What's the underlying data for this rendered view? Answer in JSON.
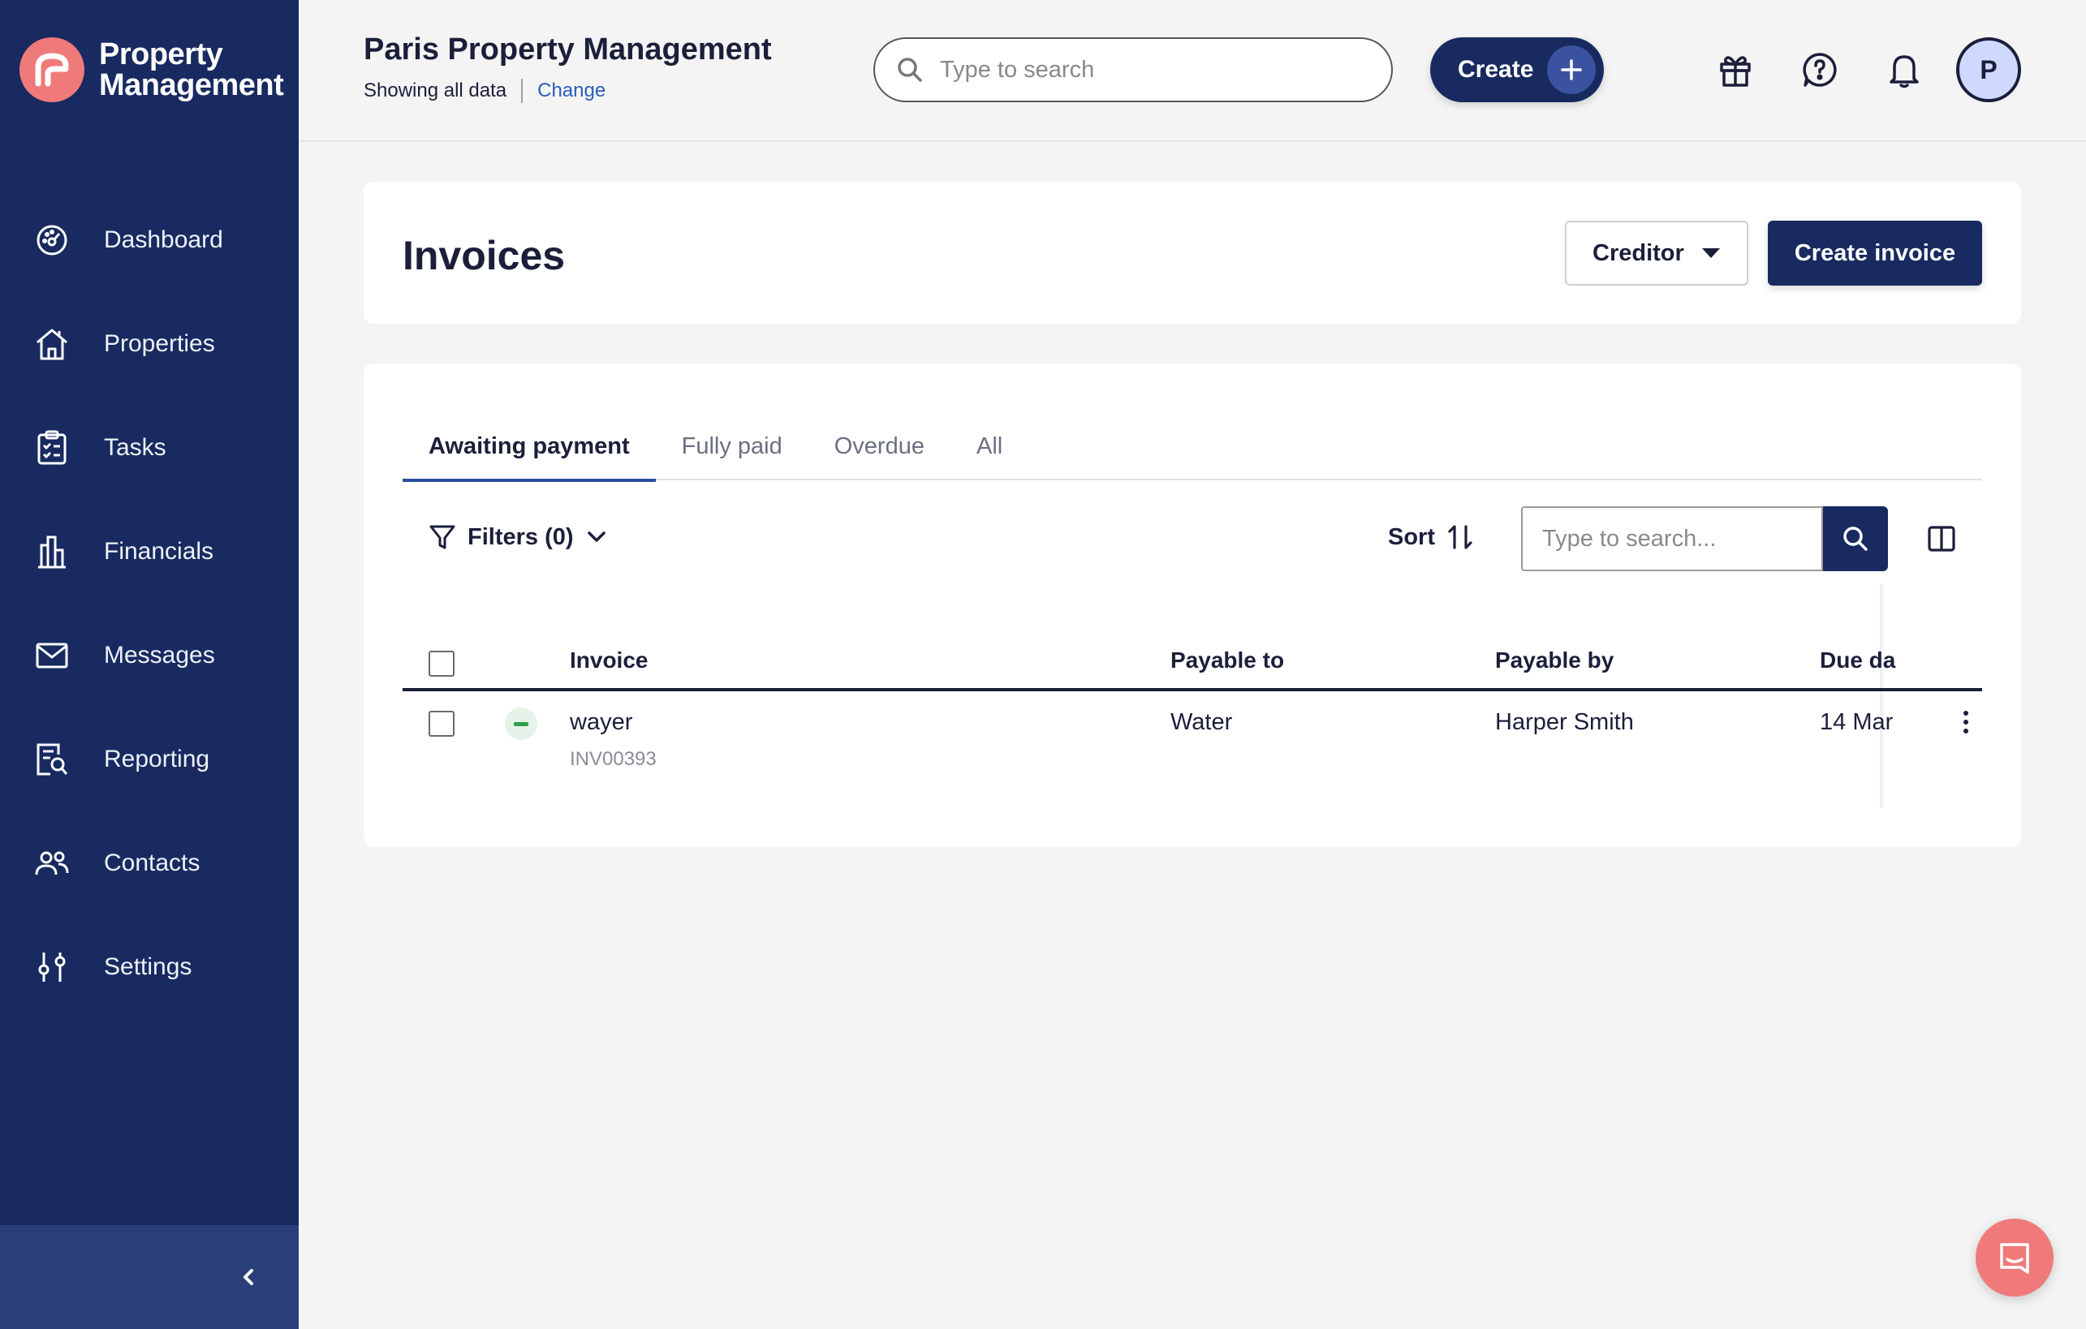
{
  "brand": {
    "name": "Property Management"
  },
  "sidebar": {
    "items": [
      {
        "label": "Dashboard",
        "icon": "dashboard-icon"
      },
      {
        "label": "Properties",
        "icon": "home-icon"
      },
      {
        "label": "Tasks",
        "icon": "clipboard-icon"
      },
      {
        "label": "Financials",
        "icon": "building-icon"
      },
      {
        "label": "Messages",
        "icon": "mail-icon"
      },
      {
        "label": "Reporting",
        "icon": "report-icon"
      },
      {
        "label": "Contacts",
        "icon": "people-icon"
      },
      {
        "label": "Settings",
        "icon": "sliders-icon"
      }
    ]
  },
  "topbar": {
    "org_title": "Paris Property Management",
    "org_subtitle": "Showing all data",
    "change_label": "Change",
    "search_placeholder": "Type to search",
    "create_label": "Create",
    "avatar_initial": "P"
  },
  "page": {
    "title": "Invoices",
    "creditor_label": "Creditor",
    "create_invoice_label": "Create invoice"
  },
  "tabs": [
    {
      "label": "Awaiting payment",
      "active": true
    },
    {
      "label": "Fully paid",
      "active": false
    },
    {
      "label": "Overdue",
      "active": false
    },
    {
      "label": "All",
      "active": false
    }
  ],
  "toolbar": {
    "filters_label": "Filters (0)",
    "sort_label": "Sort",
    "search_placeholder": "Type to search..."
  },
  "table": {
    "columns": [
      "Invoice",
      "Payable to",
      "Payable by",
      "Due da"
    ],
    "rows": [
      {
        "invoice_name": "wayer",
        "invoice_id": "INV00393",
        "payable_to": "Water",
        "payable_by": "Harper Smith",
        "due_date": "14 Mar",
        "status": "pending"
      }
    ]
  },
  "colors": {
    "sidebar": "#182a60",
    "accent": "#182a60",
    "brand_coral": "#f07a7a",
    "link": "#2b5db8",
    "status_green": "#2e9d4c"
  }
}
